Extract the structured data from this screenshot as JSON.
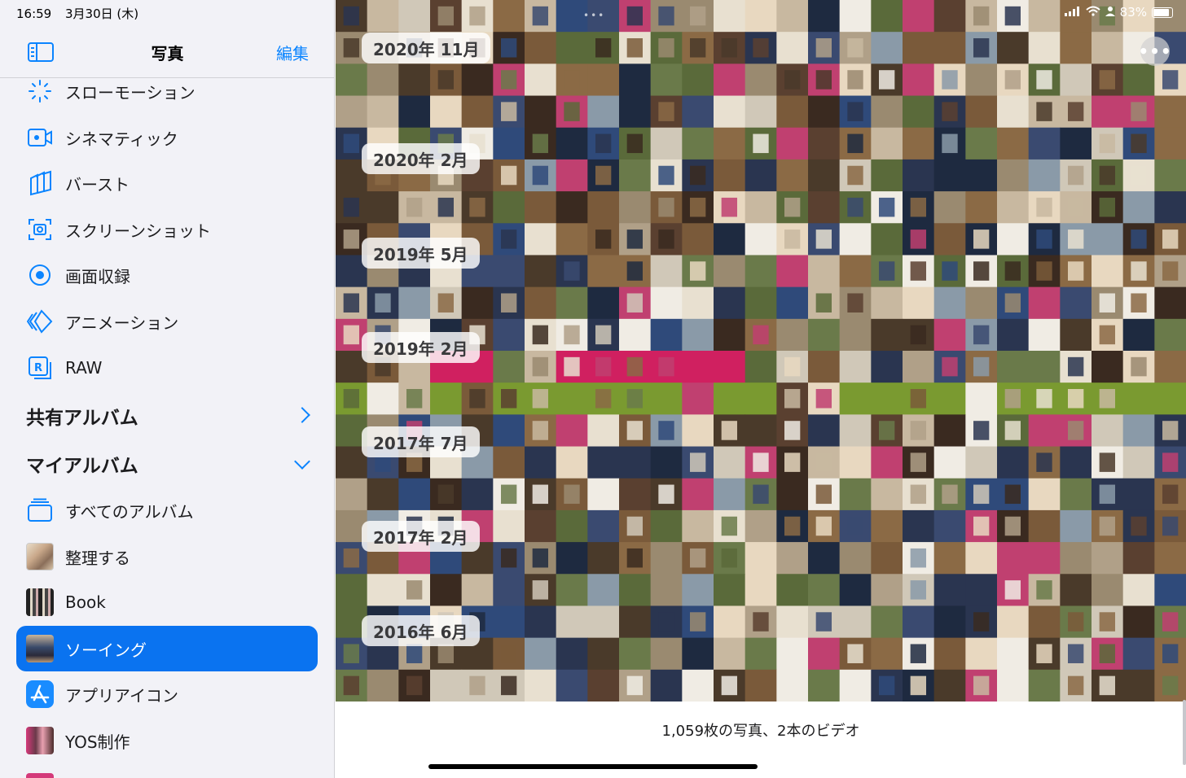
{
  "status": {
    "time": "16:59",
    "date": "3月30日 (木)",
    "battery_pct": "83%"
  },
  "sidebar": {
    "title": "写真",
    "edit_label": "編集",
    "media_types": [
      {
        "label": "スローモーション",
        "icon": "slow-motion-icon"
      },
      {
        "label": "シネマティック",
        "icon": "cinematic-icon"
      },
      {
        "label": "バースト",
        "icon": "burst-icon"
      },
      {
        "label": "スクリーンショット",
        "icon": "screenshot-icon"
      },
      {
        "label": "画面収録",
        "icon": "screen-recording-icon"
      },
      {
        "label": "アニメーション",
        "icon": "animation-icon"
      },
      {
        "label": "RAW",
        "icon": "raw-icon"
      }
    ],
    "shared_albums_label": "共有アルバム",
    "my_albums_label": "マイアルバム",
    "albums": [
      {
        "label": "すべてのアルバム",
        "icon": "all-albums-icon",
        "active": false
      },
      {
        "label": "整理する",
        "icon": "album-thumbnail",
        "active": false
      },
      {
        "label": "Book",
        "icon": "album-thumbnail",
        "active": false
      },
      {
        "label": "ソーイング",
        "icon": "album-thumbnail",
        "active": true
      },
      {
        "label": "アプリアイコン",
        "icon": "app-store-icon",
        "active": false
      },
      {
        "label": "YOS制作",
        "icon": "album-thumbnail",
        "active": false
      }
    ]
  },
  "main": {
    "year_labels": [
      "2020年 11月",
      "2020年 2月",
      "2019年 5月",
      "2019年 2月",
      "2017年 7月",
      "2017年 2月",
      "2016年 6月"
    ],
    "more_label": "•••",
    "footer_count": "1,059枚の写真、2本のビデオ"
  },
  "colors": {
    "accent": "#0a84ff",
    "active_row": "#0a73f0",
    "sidebar_bg": "#f2f2f7"
  }
}
